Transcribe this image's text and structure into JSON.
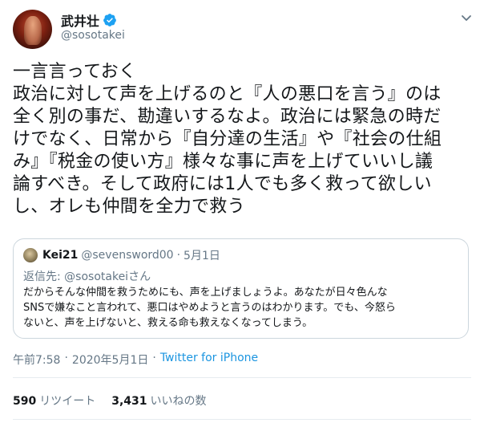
{
  "author": {
    "name": "武井壮",
    "handle": "@sosotakei",
    "verified": true
  },
  "icons": {
    "verified": "verified-badge-icon",
    "more": "chevron-down-icon",
    "accent_color": "#1da1f2"
  },
  "tweet_text": "一言言っておく\n政治に対して声を上げるのと『人の悪口を言う』のは\n全く別の事だ、勘違いするなよ。政治には緊急の時だ\nけでなく、日常から『自分達の生活』や『社会の仕組\nみ』『税金の使い方』様々な事に声を上げていいし議\n論すべき。そして政府には1人でも多く救って欲しい\nし、オレも仲間を全力で救う",
  "quoted": {
    "name": "Kei21",
    "handle": "@sevensword00",
    "separator": "·",
    "date": "5月1日",
    "reply_prefix": "返信先: ",
    "reply_mention": "@sosotakeiさん",
    "text": "だからそんな仲間を救うためにも、声を上げましょうよ。あなたが日々色んな\nSNSで嫌なこと言われて、悪口はやめようと言うのはわかります。でも、今怒ら\nないと、声を上げないと、救える命も救えなくなってしまう。"
  },
  "meta": {
    "time": "午前7:58",
    "separator": "·",
    "date": "2020年5月1日",
    "source": "Twitter for iPhone"
  },
  "stats": {
    "retweets": "590",
    "retweets_label": "リツイート",
    "likes": "3,431",
    "likes_label": "いいねの数"
  }
}
